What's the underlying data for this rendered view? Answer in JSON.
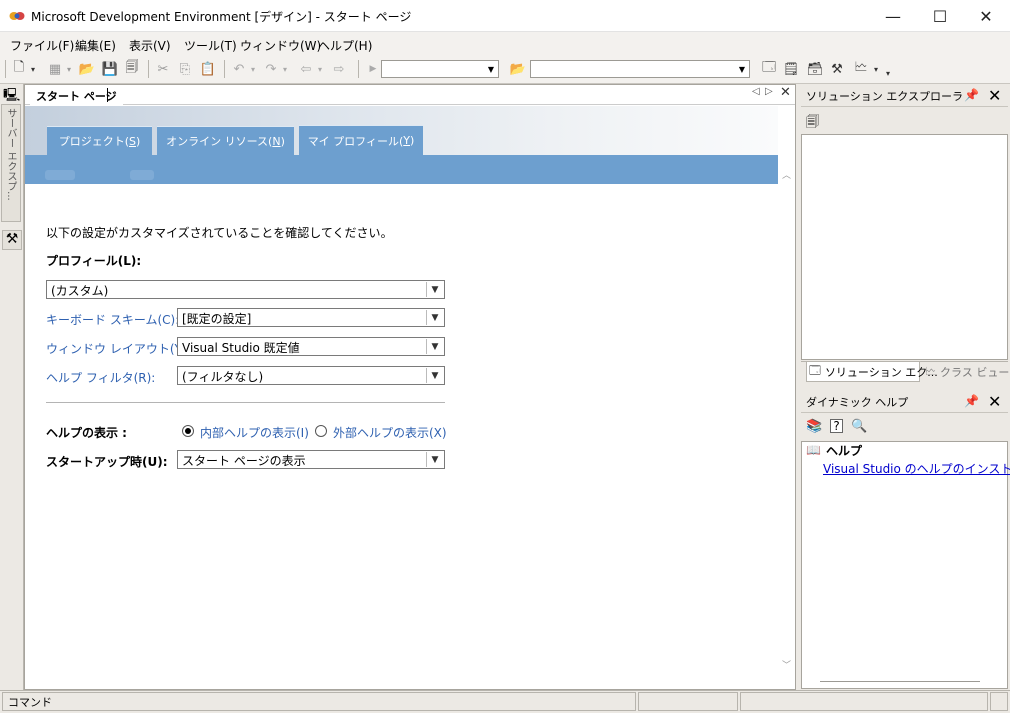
{
  "window": {
    "title": "Microsoft Development Environment [デザイン] - スタート ページ",
    "minimize": "—",
    "maximize": "☐",
    "close": "✕"
  },
  "menu": [
    "ファイル(F)",
    "編集(E)",
    "表示(V)",
    "ツール(T)",
    "ウィンドウ(W)",
    "ヘルプ(H)"
  ],
  "left_dock": {
    "server_explorer": "サーバー エクスプ..."
  },
  "document": {
    "tab_label": "スタート ページ",
    "banner_tabs": [
      {
        "label": "プロジェクト(",
        "key": "S",
        "end": ")"
      },
      {
        "label": "オンライン リソース(",
        "key": "N",
        "end": ")"
      },
      {
        "label": "マイ プロフィール(",
        "key": "Y",
        "end": ")"
      }
    ],
    "intro": "以下の設定がカスタマイズされていることを確認してください。",
    "profile_label": "プロフィール(L):",
    "profile_value": "(カスタム)",
    "keyboard_label": "キーボード スキーム(C):",
    "keyboard_value": "[既定の設定]",
    "window_layout_label": "ウィンドウ レイアウト(Y):",
    "window_layout_value": "Visual Studio 既定値",
    "help_filter_label": "ヘルプ フィルタ(R):",
    "help_filter_value": "(フィルタなし)",
    "help_display_label": "ヘルプの表示 :",
    "help_internal": "内部ヘルプの表示(I)",
    "help_external": "外部ヘルプの表示(X)",
    "startup_label": "スタートアップ時(U):",
    "startup_value": "スタート ページの表示"
  },
  "solution_explorer": {
    "title": "ソリューション エクスプローラ",
    "tab_solution": "ソリューション エク...",
    "tab_class": "クラス ビュー"
  },
  "dynamic_help": {
    "title": "ダイナミック ヘルプ",
    "section": "ヘルプ",
    "link": "Visual Studio のヘルプのインストール"
  },
  "status": {
    "command": "コマンド"
  }
}
